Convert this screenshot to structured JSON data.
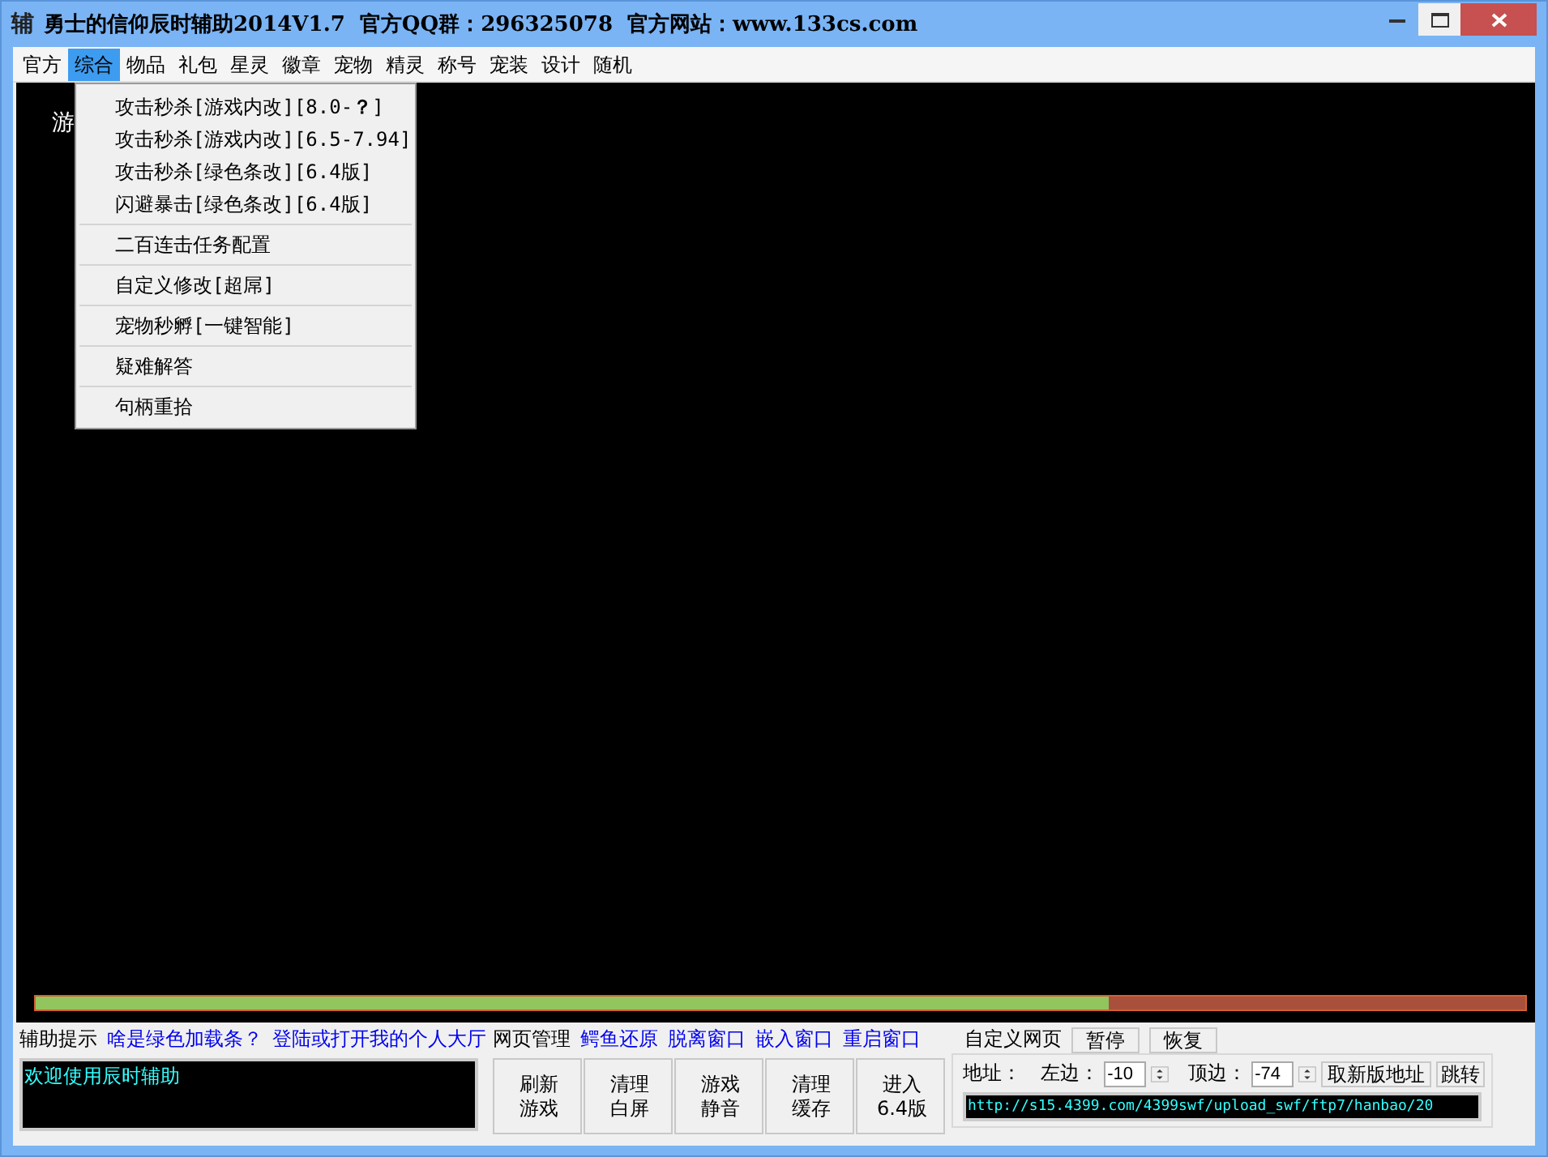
{
  "window": {
    "icon_glyph": "辅",
    "title": "勇士的信仰辰时辅助2014V1.7  官方QQ群：296325078  官方网站：www.133cs.com"
  },
  "menu": [
    {
      "label": "官方",
      "selected": false
    },
    {
      "label": "综合",
      "selected": true
    },
    {
      "label": "物品",
      "selected": false
    },
    {
      "label": "礼包",
      "selected": false
    },
    {
      "label": "星灵",
      "selected": false
    },
    {
      "label": "徽章",
      "selected": false
    },
    {
      "label": "宠物",
      "selected": false
    },
    {
      "label": "精灵",
      "selected": false
    },
    {
      "label": "称号",
      "selected": false
    },
    {
      "label": "宠装",
      "selected": false
    },
    {
      "label": "设计",
      "selected": false
    },
    {
      "label": "随机",
      "selected": false
    }
  ],
  "dropdown": {
    "groups": [
      [
        "攻击秒杀[游戏内改][8.0-**？**]",
        "攻击秒杀[游戏内改][6.5-7.94]",
        "攻击秒杀[绿色条改][6.4版]",
        "闪避暴击[绿色条改][6.4版]"
      ],
      [
        "二百连击任务配置"
      ],
      [
        "自定义修改[超屌]"
      ],
      [
        "宠物秒孵[一键智能]"
      ],
      [
        "疑难解答"
      ],
      [
        "句柄重拾"
      ]
    ]
  },
  "game": {
    "partial_text": "游",
    "loading": {
      "level": 0.72
    }
  },
  "tips": {
    "label": "辅助提示",
    "links": [
      "啥是绿色加载条？",
      "登陆或打开我的个人大厅"
    ],
    "log": "欢迎使用辰时辅助"
  },
  "web_manage": {
    "label": "网页管理",
    "links": [
      "鳄鱼还原",
      "脱离窗口",
      "嵌入窗口",
      "重启窗口"
    ],
    "buttons": [
      "刷新游戏",
      "清理白屏",
      "游戏静音",
      "清理缓存",
      "进入6.4版"
    ]
  },
  "custom_page": {
    "label": "自定义网页",
    "buttons": [
      "暂停",
      "恢复"
    ],
    "address_label": "地址：",
    "left_label": "左边：",
    "left_value": "-10",
    "top_label": "顶边：",
    "top_value": "-74",
    "fetch_button": "取新版地址",
    "go_button": "跳转",
    "url": "http://s15.4399.com/4399swf/upload_swf/ftp7/hanbao/20"
  }
}
